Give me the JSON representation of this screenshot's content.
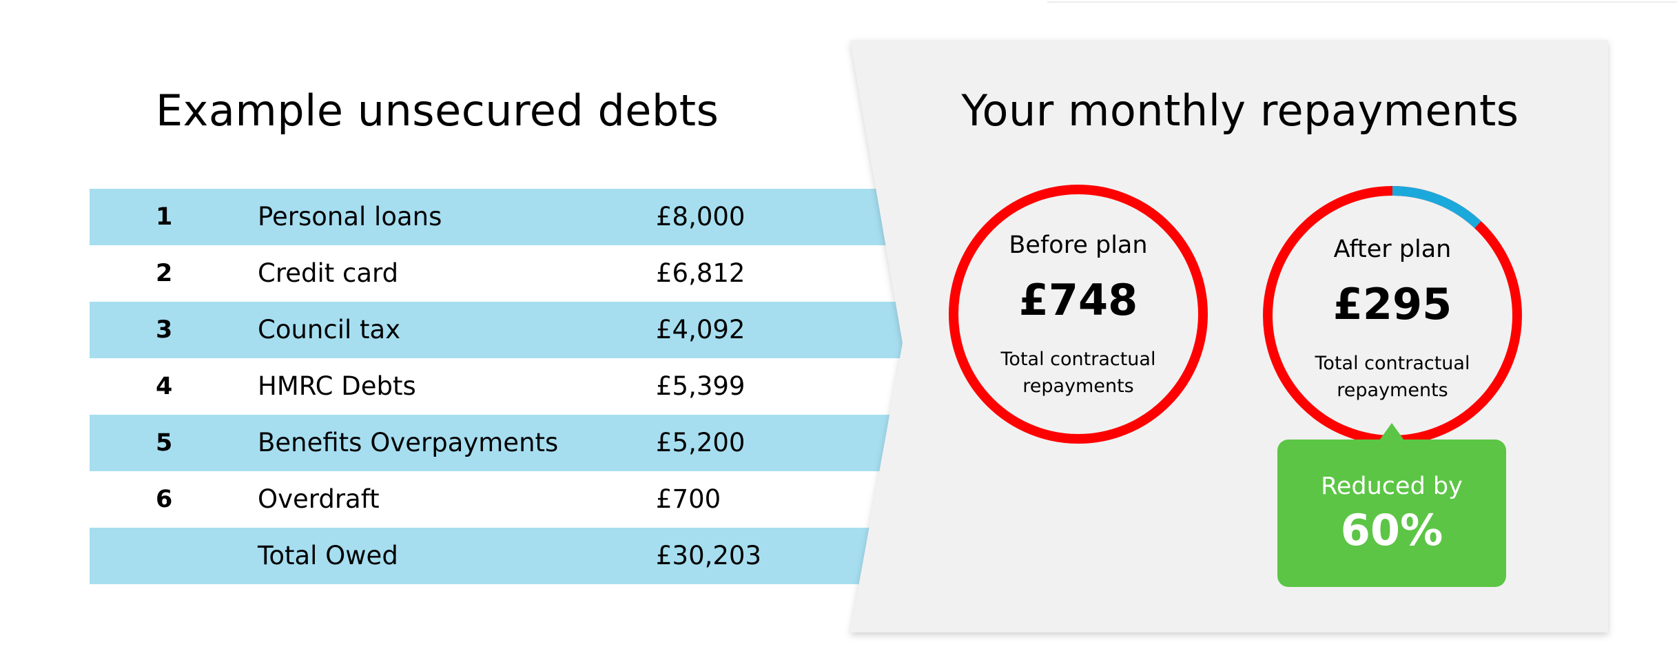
{
  "debts": {
    "title": "Example unsecured debts",
    "rows": [
      {
        "num": "1",
        "label": "Personal loans",
        "amount": "£8,000"
      },
      {
        "num": "2",
        "label": "Credit card",
        "amount": "£6,812"
      },
      {
        "num": "3",
        "label": "Council tax",
        "amount": "£4,092"
      },
      {
        "num": "4",
        "label": "HMRC Debts",
        "amount": "£5,399"
      },
      {
        "num": "5",
        "label": "Benefits Overpayments",
        "amount": "£5,200"
      },
      {
        "num": "6",
        "label": "Overdraft",
        "amount": "£700"
      }
    ],
    "total": {
      "label": "Total Owed",
      "amount": "£30,203"
    }
  },
  "repayments": {
    "title": "Your monthly repayments",
    "before": {
      "caption": "Before plan",
      "value": "£748",
      "sub_line1": "Total contractual",
      "sub_line2": "repayments"
    },
    "after": {
      "caption": "After plan",
      "value": "£295",
      "sub_line1": "Total contractual",
      "sub_line2": "repayments",
      "reduced_share": 0.12
    },
    "reduction": {
      "label": "Reduced by",
      "value": "60%"
    }
  },
  "colors": {
    "row_shade": "#a6def0",
    "panel": "#f1f1f1",
    "ring_red": "#ff0000",
    "ring_blue": "#1ba9dc",
    "badge_green": "#5cc545"
  }
}
